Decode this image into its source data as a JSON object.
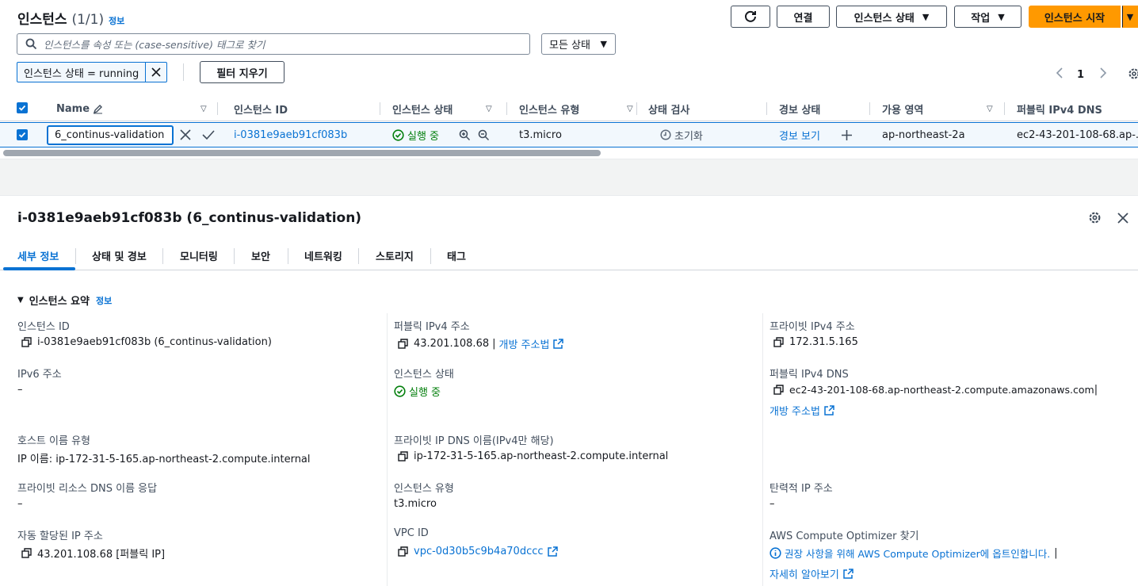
{
  "header": {
    "title": "인스턴스",
    "count": "(1/1)",
    "info": "정보",
    "buttons": {
      "refresh": "",
      "connect": "연결",
      "instance_state": "인스턴스 상태",
      "actions": "작업",
      "launch": "인스턴스 시작"
    },
    "search_placeholder": "인스턴스를 속성 또는 (case-sensitive) 태그로 찾기",
    "state_filter": "모든 상태",
    "filter_token": "인스턴스 상태 = running",
    "clear_filters": "필터 지우기",
    "page": "1"
  },
  "table": {
    "columns": [
      "Name",
      "인스턴스 ID",
      "인스턴스 상태",
      "인스턴스 유형",
      "상태 검사",
      "경보 상태",
      "가용 영역",
      "퍼블릭 IPv4 DNS"
    ],
    "row": {
      "name": "6_continus-validation",
      "instance_id": "i-0381e9aeb91cf083b",
      "state": "실행 중",
      "type": "t3.micro",
      "status_check": "초기화",
      "alarm": "경보 보기",
      "az": "ap-northeast-2a",
      "dns": "ec2-43-201-108-68.ap-..."
    }
  },
  "panel": {
    "title": "i-0381e9aeb91cf083b (6_continus-validation)",
    "tabs": [
      "세부 정보",
      "상태 및 경보",
      "모니터링",
      "보안",
      "네트워킹",
      "스토리지",
      "태그"
    ],
    "section": "인스턴스 요약",
    "section_info": "정보",
    "col1": {
      "instance_id_label": "인스턴스 ID",
      "instance_id_value": "i-0381e9aeb91cf083b (6_continus-validation)",
      "ipv6_label": "IPv6 주소",
      "ipv6_value": "–",
      "hostname_type_label": "호스트 이름 유형",
      "hostname_type_value": "IP 이름: ip-172-31-5-165.ap-northeast-2.compute.internal",
      "private_dns_answer_label": "프라이빗 리소스 DNS 이름 응답",
      "private_dns_answer_value": "–",
      "auto_ip_label": "자동 할당된 IP 주소",
      "auto_ip_value": "43.201.108.68 [퍼블릭 IP]"
    },
    "col2": {
      "public_ip_label": "퍼블릭 IPv4 주소",
      "public_ip_value": "43.201.108.68",
      "public_ip_sep": "|",
      "public_ip_link": "개방 주소법",
      "state_label": "인스턴스 상태",
      "state_value": "실행 중",
      "private_dns_label": "프라이빗 IP DNS 이름(IPv4만 해당)",
      "private_dns_value": "ip-172-31-5-165.ap-northeast-2.compute.internal",
      "type_label": "인스턴스 유형",
      "type_value": "t3.micro",
      "vpc_label": "VPC ID",
      "vpc_value": "vpc-0d30b5c9b4a70dccc"
    },
    "col3": {
      "private_ip_label": "프라이빗 IPv4 주소",
      "private_ip_value": "172.31.5.165",
      "public_dns_label": "퍼블릭 IPv4 DNS",
      "public_dns_value": "ec2-43-201-108-68.ap-northeast-2.compute.amazonaws.com",
      "public_dns_sep": "|",
      "public_dns_link": "개방 주소법",
      "elastic_label": "탄력적 IP 주소",
      "elastic_value": "–",
      "optimizer_label": "AWS Compute Optimizer 찾기",
      "optimizer_value": "권장 사항을 위해 AWS Compute Optimizer에 옵트인합니다.",
      "optimizer_sep": "|",
      "optimizer_link": "자세히 알아보기"
    }
  }
}
